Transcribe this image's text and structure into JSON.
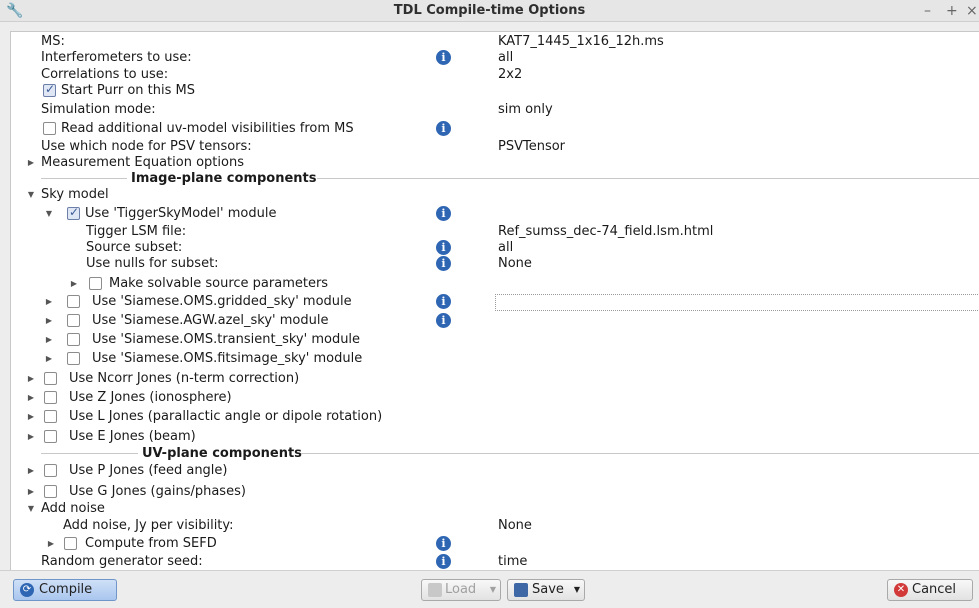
{
  "window": {
    "title": "TDL Compile-time Options",
    "controls": {
      "minimize": "–",
      "maximize": "+",
      "close": "×"
    },
    "app_icon": "wrench-icon"
  },
  "options": {
    "ms_label": "MS:",
    "ms_value": "KAT7_1445_1x16_12h.ms",
    "interferometers_label": "Interferometers to use:",
    "interferometers_value": "all",
    "correlations_label": "Correlations to use:",
    "correlations_value": "2x2",
    "start_purr_label": "Start Purr on this MS",
    "simulation_mode_label": "Simulation mode:",
    "simulation_mode_value": "sim only",
    "read_additional_label": "Read additional uv-model visibilities from MS",
    "psv_node_label": "Use which node for PSV tensors:",
    "psv_node_value": "PSVTensor",
    "measurement_eq_label": "Measurement Equation options"
  },
  "image_plane": {
    "section_title": "Image-plane components",
    "sky_model_label": "Sky model",
    "tigger_module_label": "Use 'TiggerSkyModel' module",
    "tigger_lsm_label": "Tigger LSM file:",
    "tigger_lsm_value": "Ref_sumss_dec-74_field.lsm.html",
    "source_subset_label": "Source subset:",
    "source_subset_value": "all",
    "use_nulls_label": "Use nulls for subset:",
    "use_nulls_value": "None",
    "make_solvable_label": "Make solvable source parameters",
    "gridded_sky_label": "Use 'Siamese.OMS.gridded_sky' module",
    "azel_sky_label": "Use 'Siamese.AGW.azel_sky' module",
    "transient_sky_label": "Use 'Siamese.OMS.transient_sky' module",
    "fitsimage_sky_label": "Use 'Siamese.OMS.fitsimage_sky' module",
    "ncorr_jones_label": "Use Ncorr Jones (n-term correction)",
    "z_jones_label": "Use Z Jones (ionosphere)",
    "l_jones_label": "Use L Jones (parallactic angle or dipole rotation)",
    "e_jones_label": "Use E Jones (beam)"
  },
  "uv_plane": {
    "section_title": "UV-plane components",
    "p_jones_label": "Use P Jones (feed angle)",
    "g_jones_label": "Use G Jones (gains/phases)",
    "add_noise_label": "Add noise",
    "noise_per_vis_label": "Add noise, Jy per visibility:",
    "noise_per_vis_value": "None",
    "compute_sefd_label": "Compute from SEFD",
    "random_seed_label": "Random generator seed:",
    "random_seed_value": "time"
  },
  "buttons": {
    "compile": "Compile",
    "load": "Load",
    "save": "Save",
    "cancel": "Cancel"
  },
  "colors": {
    "info_icon": "#2f66b3",
    "compile_button": "#a9c6ee",
    "cancel_icon": "#d23a3a"
  }
}
